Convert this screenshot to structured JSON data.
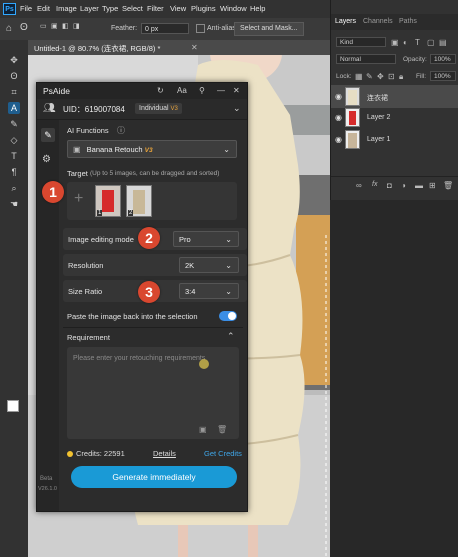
{
  "menubar": {
    "logo": "Ps",
    "items": [
      "File",
      "Edit",
      "Image",
      "Layer",
      "Type",
      "Select",
      "Filter",
      "View",
      "Plugins",
      "Window",
      "Help"
    ]
  },
  "options_bar": {
    "feather_label": "Feather:",
    "feather_value": "0 px",
    "antialias_label": "Anti-alias",
    "select_mask_label": "Select and Mask..."
  },
  "document": {
    "tab_title": "Untitled-1 @ 80.7% (连衣裙, RGB/8) *"
  },
  "layers_panel": {
    "tabs": [
      "Layers",
      "Channels",
      "Paths"
    ],
    "filter_kind": "Kind",
    "blend_mode": "Normal",
    "opacity_label": "Opacity:",
    "opacity_value": "100%",
    "lock_label": "Lock:",
    "fill_label": "Fill:",
    "fill_value": "100%",
    "layers": [
      {
        "name": "连衣裙"
      },
      {
        "name": "Layer 2"
      },
      {
        "name": "Layer 1"
      }
    ],
    "footer_fx": "fx"
  },
  "psaide": {
    "title": "PsAide",
    "uid": "UID：619007084",
    "plan": "Individual",
    "plan_badge": "V3",
    "ai_functions_label": "AI Functions",
    "ai_function_value": "Banana Retouch",
    "ai_function_badge": "V3",
    "target_label": "Target",
    "target_hint": "(Up to 5 images, can be dragged and sorted)",
    "target_thumbs": [
      "1",
      "2"
    ],
    "image_mode_label": "Image editing mode",
    "image_mode_value": "Pro",
    "resolution_label": "Resolution",
    "resolution_value": "2K",
    "size_ratio_label": "Size Ratio",
    "size_ratio_value": "3:4",
    "paste_back_label": "Paste the image back into the selection",
    "requirement_label": "Requirement",
    "requirement_placeholder": "Please enter your retouching requirements",
    "credits_label": "Credits: 22591",
    "details_link": "Details",
    "get_credits_link": "Get Credits",
    "generate_label": "Generate immediately",
    "beta_label": "Beta",
    "version_label": "V26.1.0",
    "step_badges": [
      "1",
      "2",
      "3"
    ]
  }
}
